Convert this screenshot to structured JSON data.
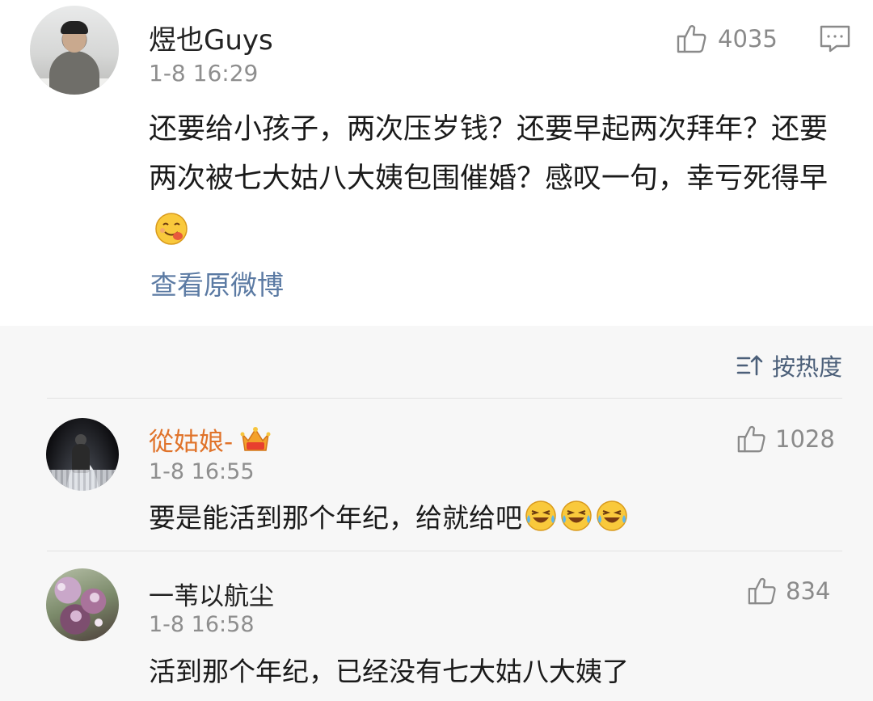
{
  "post": {
    "username": "煜也Guys",
    "time": "1-8 16:29",
    "likes": "4035",
    "content": "还要给小孩子，两次压岁钱？还要早起两次拜年？还要两次被七大姑八大姨包围催婚？感叹一句，幸亏死得早",
    "content_emoji": "yummy-face-emoji",
    "view_original": "查看原微博"
  },
  "sort": {
    "label": "按热度",
    "icon": "sort-icon"
  },
  "replies": [
    {
      "username": "從姑娘-",
      "username_color": "#e0732a",
      "badge": "crown-member-icon",
      "time": "1-8 16:55",
      "likes": "1028",
      "text": "要是能活到那个年纪，给就给吧",
      "emojis": [
        "laugh-cry-emoji",
        "laugh-cry-emoji",
        "laugh-cry-emoji"
      ]
    },
    {
      "username": "一苇以航尘",
      "username_color": "#222222",
      "time": "1-8 16:58",
      "likes": "834",
      "text": "活到那个年纪，已经没有七大姑八大姨了"
    }
  ],
  "colors": {
    "link_blue": "#5b7aa3",
    "muted_gray": "#8e8e8e",
    "vip_orange": "#e0732a"
  }
}
